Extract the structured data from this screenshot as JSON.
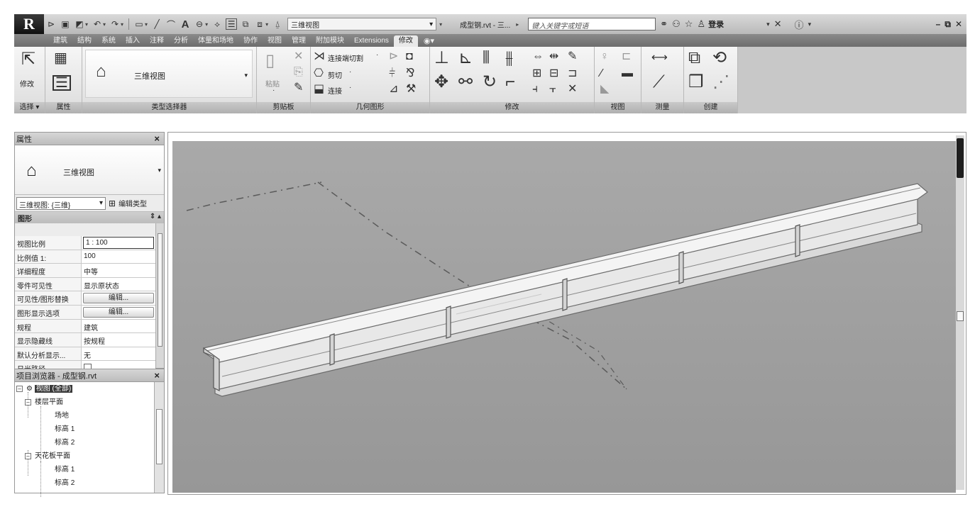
{
  "titlebar": {
    "app_logo": "R",
    "view_name": "三维视图",
    "doc_title": "成型钢.rvt - 三...",
    "search_placeholder": "键入关键字或短语",
    "login": "登录"
  },
  "ribbon_tabs": [
    "建筑",
    "结构",
    "系统",
    "插入",
    "注释",
    "分析",
    "体量和场地",
    "协作",
    "视图",
    "管理",
    "附加模块",
    "Extensions",
    "修改"
  ],
  "active_tab": "修改",
  "ribbon": {
    "modify_label": "修改",
    "select_label": "选择",
    "properties_label": "属性",
    "type_selector_value": "三维视图",
    "type_selector_label": "类型选择器",
    "clipboard_paste": "粘贴",
    "clipboard_label": "剪贴板",
    "join_cut": "连接端切割",
    "cut": "剪切",
    "join": "连接",
    "geometry_label": "几何图形",
    "modify_panel_label": "修改",
    "view_label": "视图",
    "measure_label": "测量",
    "create_label": "创建"
  },
  "properties": {
    "title": "属性",
    "type_name": "三维视图",
    "filter_value": "三维视图: {三维}",
    "edit_type": "编辑类型",
    "group": "图形",
    "rows": [
      {
        "name": "视图比例",
        "value": "1 : 100"
      },
      {
        "name": "比例值 1:",
        "value": "100"
      },
      {
        "name": "详细程度",
        "value": "中等"
      },
      {
        "name": "零件可见性",
        "value": "显示原状态"
      },
      {
        "name": "可见性/图形替换",
        "button": "编辑..."
      },
      {
        "name": "图形显示选项",
        "button": "编辑..."
      },
      {
        "name": "规程",
        "value": "建筑"
      },
      {
        "name": "显示隐藏线",
        "value": "按规程"
      },
      {
        "name": "默认分析显示...",
        "value": "无"
      },
      {
        "name": "日光路径",
        "checkbox": false
      }
    ]
  },
  "browser": {
    "title": "项目浏览器 - 成型钢.rvt",
    "items": [
      {
        "label": "视图 (全部)",
        "level": 0
      },
      {
        "label": "楼层平面",
        "level": 1
      },
      {
        "label": "场地",
        "level": 2
      },
      {
        "label": "标高 1",
        "level": 2
      },
      {
        "label": "标高 2",
        "level": 2
      },
      {
        "label": "天花板平面",
        "level": 1
      },
      {
        "label": "标高 1",
        "level": 2
      },
      {
        "label": "标高 2",
        "level": 2
      }
    ]
  },
  "colors": {
    "viewport": "#a3a3a3",
    "beam_top": "#f2f2f2",
    "beam_web": "#e6e6e6",
    "beam_edge": "#6a6a6a"
  },
  "icons": [
    "select-arrow-icon",
    "house-icon",
    "paste-icon",
    "scissors-icon",
    "move-icon",
    "rotate-icon",
    "mirror-icon",
    "array-icon",
    "measure-icon",
    "create-group-icon",
    "binoculars-icon",
    "star-icon",
    "user-icon",
    "help-icon"
  ]
}
